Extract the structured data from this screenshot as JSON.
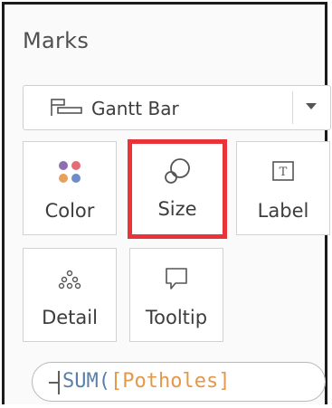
{
  "panel": {
    "title": "Marks"
  },
  "mark_type": {
    "icon": "gantt-bar-icon",
    "label": "Gantt Bar"
  },
  "cards": {
    "color": {
      "label": "Color",
      "icon": "color-dots-icon",
      "colors": [
        "#8d6fb0",
        "#e56b78",
        "#e8a15a",
        "#6f8cc9"
      ]
    },
    "size": {
      "label": "Size",
      "icon": "size-icon",
      "highlight_color": "#e8333a"
    },
    "label": {
      "label": "Label",
      "icon": "label-icon"
    },
    "detail": {
      "label": "Detail",
      "icon": "detail-icon"
    },
    "tooltip": {
      "label": "Tooltip",
      "icon": "tooltip-icon"
    }
  },
  "pill": {
    "function": "SUM(",
    "field": "[Potholes]",
    "function_color": "#5a7fa8",
    "field_color": "#e5984a"
  }
}
